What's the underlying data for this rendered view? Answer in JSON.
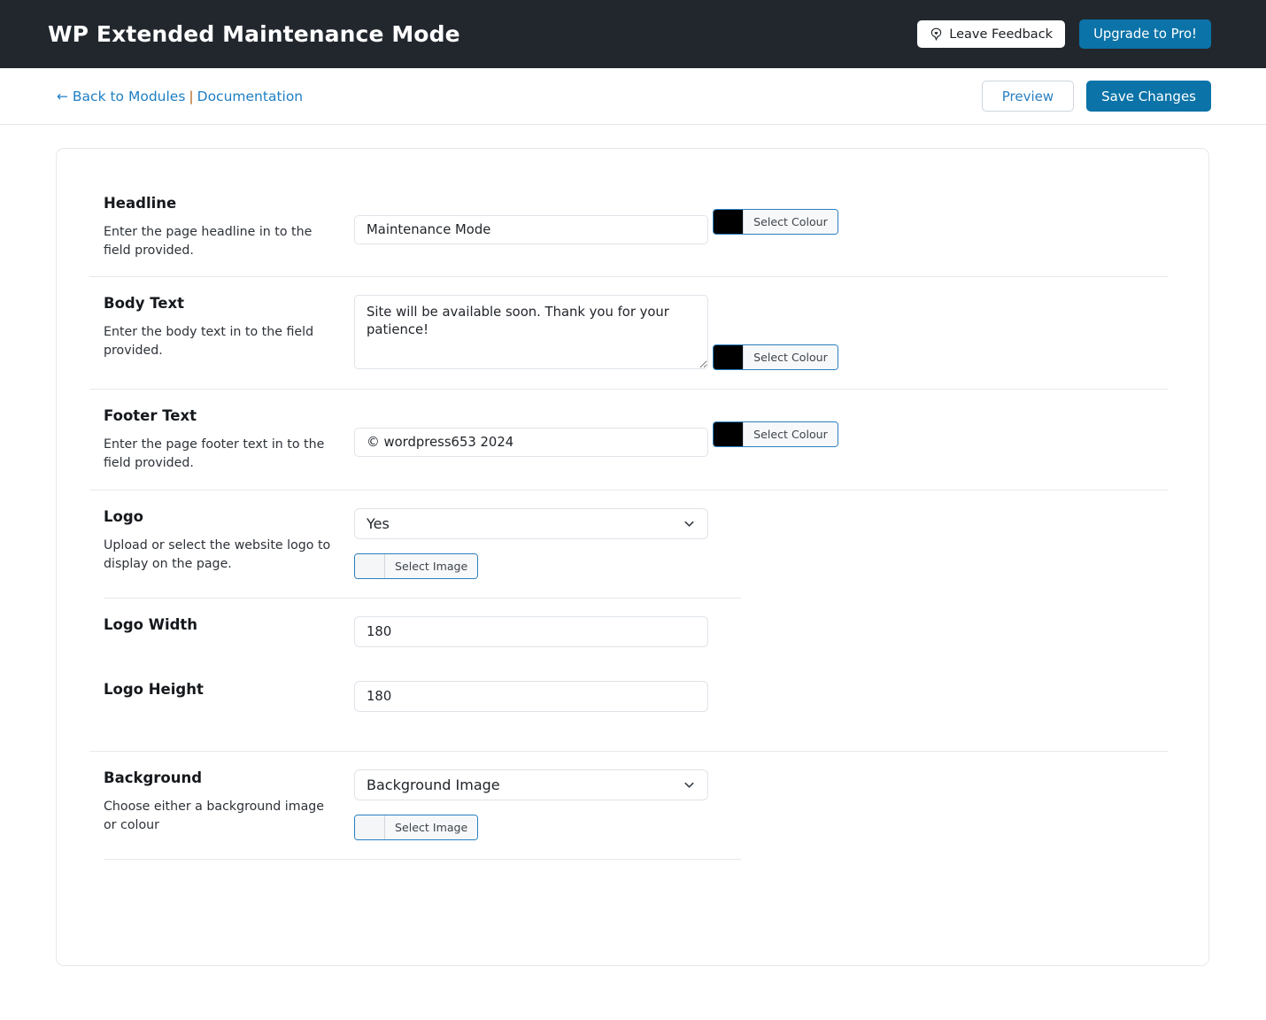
{
  "header": {
    "title": "WP Extended Maintenance Mode",
    "feedback_button": "Leave Feedback",
    "feedback_icon": "feedback-heart-icon",
    "upgrade_button": "Upgrade to Pro!",
    "background_color": "#22272e",
    "accent_color": "#0b73a8"
  },
  "subbar": {
    "back_link": "← Back to Modules",
    "separator": "|",
    "docs_link": "Documentation",
    "preview_button": "Preview",
    "save_button": "Save Changes",
    "link_color": "#1f7fc4"
  },
  "sections": {
    "headline": {
      "title": "Headline",
      "description": "Enter the page headline in to the field provided.",
      "value": "Maintenance Mode",
      "colour_button": "Select Colour",
      "colour_value": "#000000"
    },
    "body_text": {
      "title": "Body Text",
      "description": "Enter the body text in to the field provided.",
      "value": "Site will be available soon. Thank you for your patience!",
      "colour_button": "Select Colour",
      "colour_value": "#000000"
    },
    "footer_text": {
      "title": "Footer Text",
      "description": "Enter the page footer text in to the field provided.",
      "value": "© wordpress653 2024",
      "colour_button": "Select Colour",
      "colour_value": "#000000"
    },
    "logo": {
      "title": "Logo",
      "description": "Upload or select the website logo to display on the page.",
      "selected_option": "Yes",
      "image_button": "Select Image"
    },
    "logo_width": {
      "title": "Logo Width",
      "value": "180"
    },
    "logo_height": {
      "title": "Logo Height",
      "value": "180"
    },
    "background": {
      "title": "Background",
      "description": "Choose either a background image or colour",
      "selected_option": "Background Image",
      "image_button": "Select Image"
    }
  }
}
